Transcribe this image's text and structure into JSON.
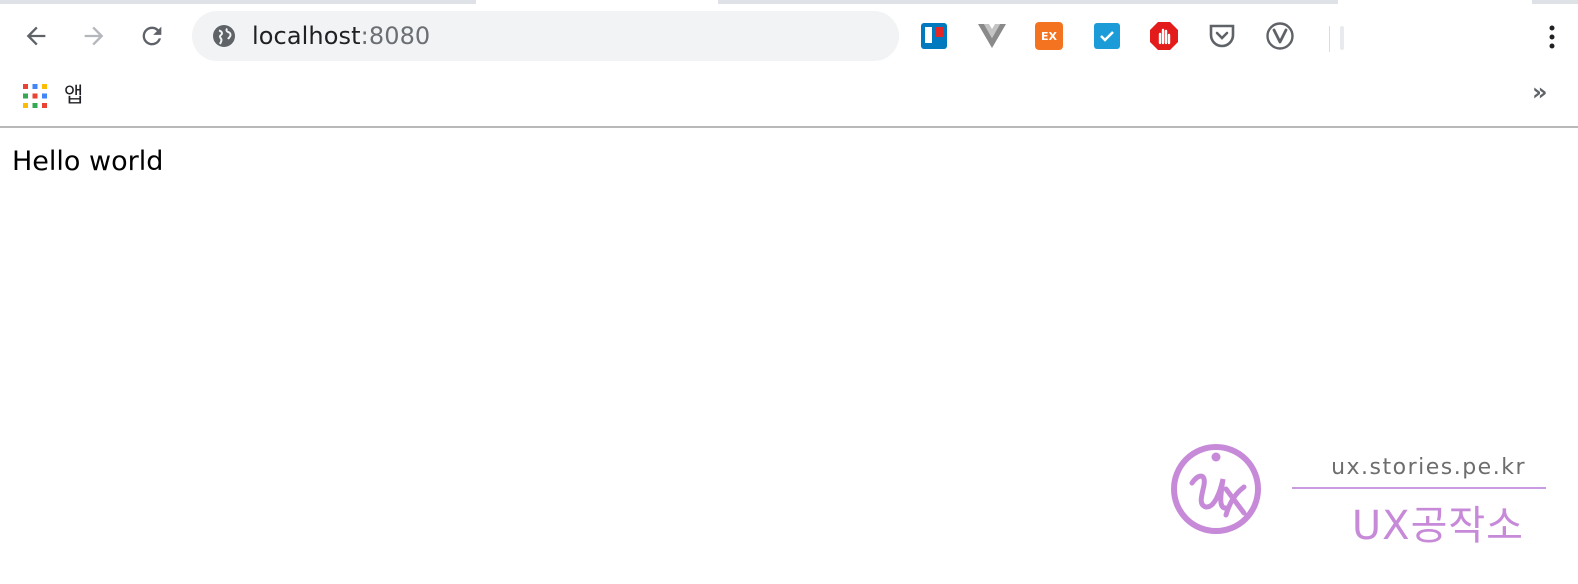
{
  "toolbar": {
    "back_icon": "arrow-left-icon",
    "forward_icon": "arrow-right-icon",
    "reload_icon": "reload-icon",
    "address": {
      "host": "localhost",
      "port": ":8080"
    },
    "extensions": [
      {
        "name": "trello-extension",
        "color": "#0079bf"
      },
      {
        "name": "vue-devtools-extension",
        "color": "#8a8a8a"
      },
      {
        "name": "ex-extension",
        "color": "#f47321"
      },
      {
        "name": "task-check-extension",
        "color": "#1b9cd8"
      },
      {
        "name": "adblock-extension",
        "color": "#e41b1b"
      },
      {
        "name": "pocket-extension",
        "color": "#5f6368"
      },
      {
        "name": "vivaldi-extension",
        "color": "#5f6368"
      }
    ],
    "menu_icon": "kebab-menu-icon"
  },
  "bookmarks": {
    "apps_label": "앱",
    "more_label": "»"
  },
  "page": {
    "body_text": "Hello world"
  },
  "watermark": {
    "site": "ux.stories.pe.kr",
    "brand": "UX공작소",
    "color": "#c78ad8"
  }
}
